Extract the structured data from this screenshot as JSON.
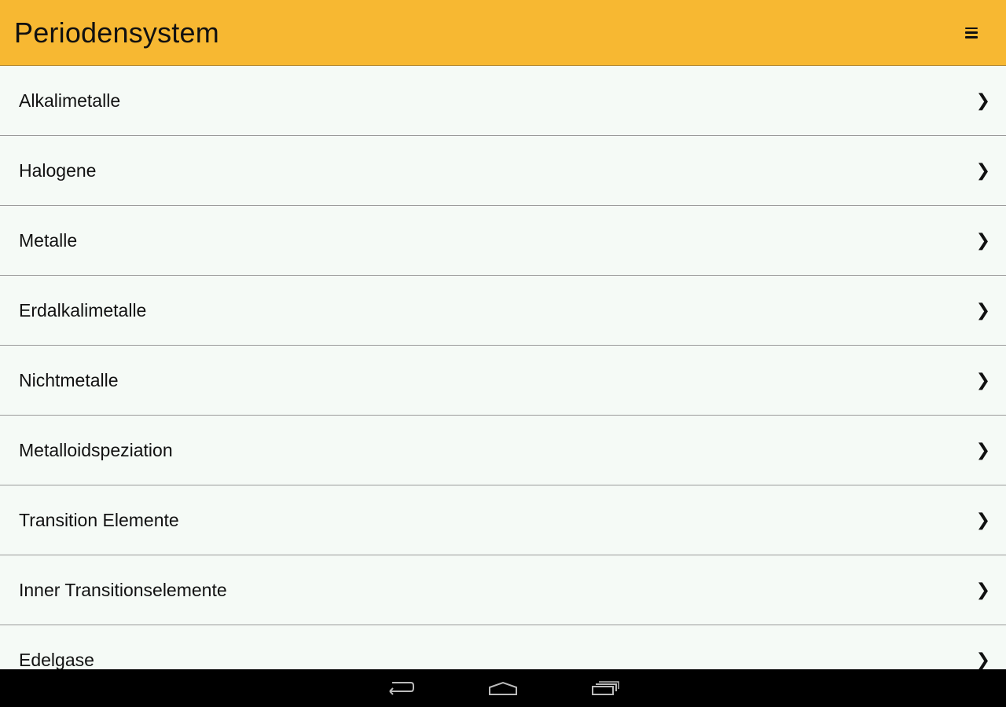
{
  "header": {
    "title": "Periodensystem",
    "menu_icon": "hamburger-menu-icon"
  },
  "list": {
    "items": [
      {
        "label": "Alkalimetalle"
      },
      {
        "label": "Halogene"
      },
      {
        "label": "Metalle"
      },
      {
        "label": "Erdalkalimetalle"
      },
      {
        "label": "Nichtmetalle"
      },
      {
        "label": "Metalloidspeziation"
      },
      {
        "label": "Transition Elemente"
      },
      {
        "label": "Inner Transitionselemente"
      },
      {
        "label": "Edelgase"
      }
    ],
    "chevron": "❯"
  },
  "navbar": {
    "buttons": [
      "back-icon",
      "home-icon",
      "recent-apps-icon"
    ]
  },
  "colors": {
    "header_bg": "#f7b832",
    "list_bg": "#f5faf6",
    "navbar_bg": "#000000"
  }
}
